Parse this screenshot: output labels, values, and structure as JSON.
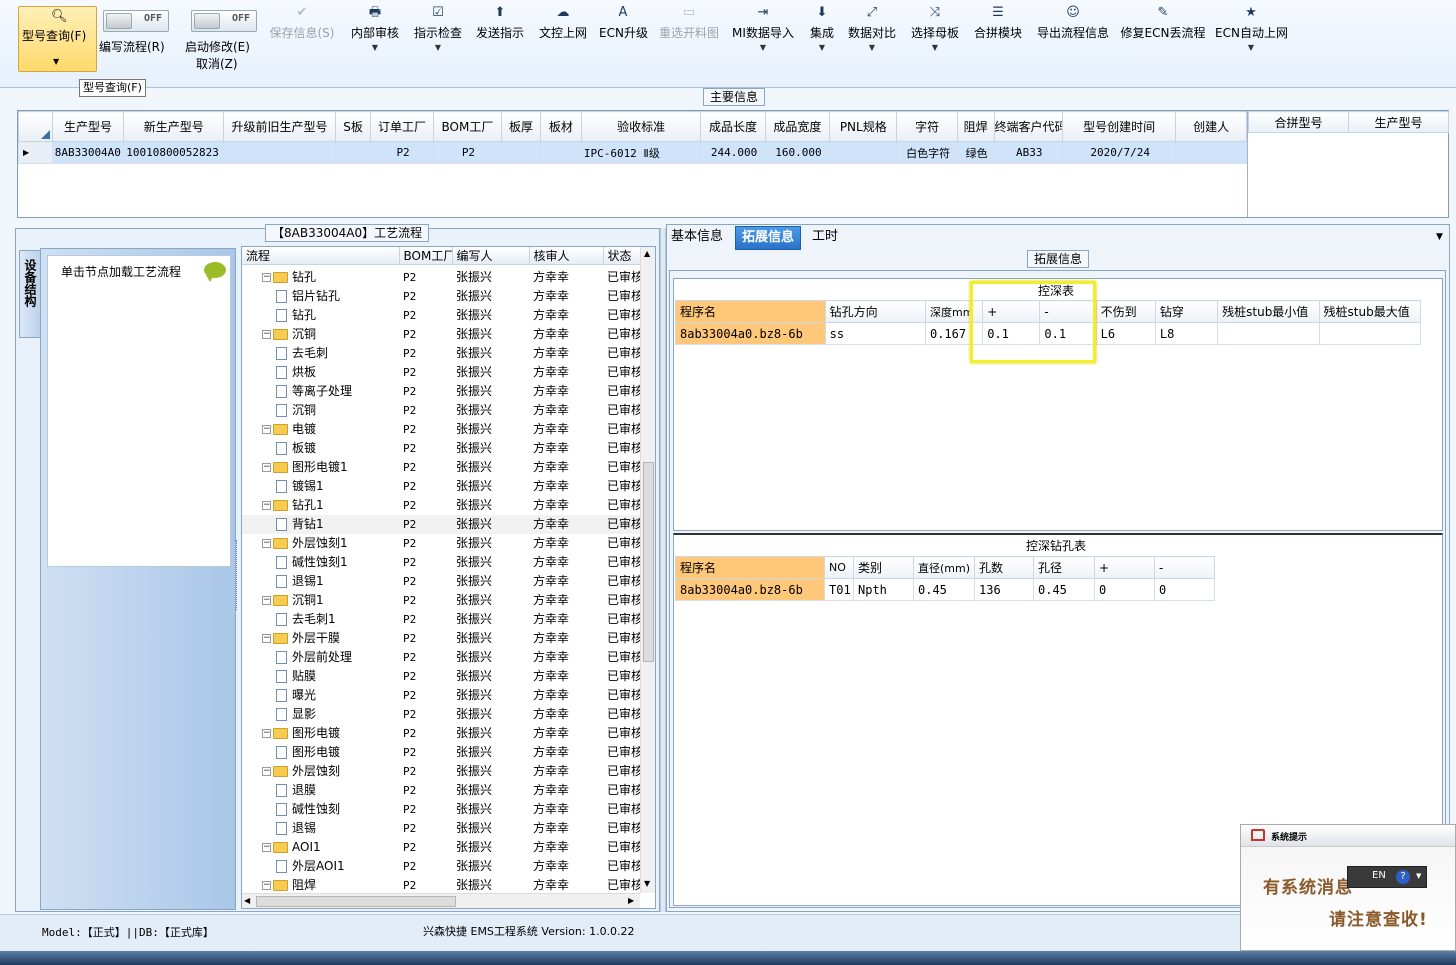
{
  "toolbar": {
    "query_label": "型号查询(F)",
    "edit_flow_label": "编写流程(R)",
    "edit_flow_toggle": "OFF",
    "start_modify_label": "启动修改(E)",
    "start_modify_toggle": "OFF",
    "cancel_label": "取消(Z)",
    "buttons": [
      {
        "label": "保存信息(S)",
        "icon": "✔",
        "disabled": true
      },
      {
        "label": "内部审核",
        "icon": "🖶",
        "disabled": false
      },
      {
        "label": "指示检查",
        "icon": "☑",
        "disabled": false
      },
      {
        "label": "发送指示",
        "icon": "⬆",
        "disabled": false
      },
      {
        "label": "文控上网",
        "icon": "☁",
        "disabled": false
      },
      {
        "label": "ECN升级",
        "icon": "A",
        "disabled": false
      },
      {
        "label": "重选开料图",
        "icon": "▭",
        "disabled": true
      },
      {
        "label": "MI数据导入",
        "icon": "⇥",
        "disabled": false
      },
      {
        "label": "集成",
        "icon": "⬇",
        "disabled": false
      },
      {
        "label": "数据对比",
        "icon": "⤢",
        "disabled": false
      },
      {
        "label": "选择母板",
        "icon": "⤨",
        "disabled": false
      },
      {
        "label": "合拼模块",
        "icon": "☰",
        "disabled": false
      },
      {
        "label": "导出流程信息",
        "icon": "☺",
        "disabled": false
      },
      {
        "label": "修复ECN丢流程",
        "icon": "✎",
        "disabled": false
      },
      {
        "label": "ECN自动上网",
        "icon": "★",
        "disabled": false
      }
    ],
    "tooltip": "型号查询(F)"
  },
  "main_info": {
    "caption": "主要信息",
    "columns": [
      "生产型号",
      "新生产型号",
      "升级前旧生产型号",
      "S板",
      "订单工厂",
      "BOM工厂",
      "板厚",
      "板材",
      "验收标准",
      "成品长度",
      "成品宽度",
      "PNL规格",
      "字符",
      "阻焊",
      "终端客户代码",
      "型号创建时间",
      "创建人"
    ],
    "row": [
      "8AB33004A0",
      "10010800052823",
      "",
      "",
      "P2",
      "P2",
      "",
      "",
      "IPC-6012 Ⅱ级",
      "244.000",
      "160.000",
      "",
      "白色字符",
      "绿色",
      "AB33",
      "2020/7/24",
      ""
    ],
    "merge_columns": [
      "合拼型号",
      "生产型号"
    ]
  },
  "flow": {
    "caption": "【8AB33004A0】工艺流程",
    "side_tab": "设备结构",
    "hint": "单击节点加载工艺流程",
    "columns": [
      "流程",
      "BOM工厂",
      "编写人",
      "核审人",
      "状态"
    ],
    "rows": [
      {
        "name": "钻孔",
        "level": 0,
        "bom": "P2",
        "writer": "张振兴",
        "reviewer": "方幸幸",
        "status": "已审核"
      },
      {
        "name": "铝片钻孔",
        "level": 1,
        "bom": "P2",
        "writer": "张振兴",
        "reviewer": "方幸幸",
        "status": "已审核"
      },
      {
        "name": "钻孔",
        "level": 1,
        "bom": "P2",
        "writer": "张振兴",
        "reviewer": "方幸幸",
        "status": "已审核"
      },
      {
        "name": "沉铜",
        "level": 0,
        "bom": "P2",
        "writer": "张振兴",
        "reviewer": "方幸幸",
        "status": "已审核"
      },
      {
        "name": "去毛刺",
        "level": 1,
        "bom": "P2",
        "writer": "张振兴",
        "reviewer": "方幸幸",
        "status": "已审核"
      },
      {
        "name": "烘板",
        "level": 1,
        "bom": "P2",
        "writer": "张振兴",
        "reviewer": "方幸幸",
        "status": "已审核"
      },
      {
        "name": "等离子处理",
        "level": 1,
        "bom": "P2",
        "writer": "张振兴",
        "reviewer": "方幸幸",
        "status": "已审核"
      },
      {
        "name": "沉铜",
        "level": 1,
        "bom": "P2",
        "writer": "张振兴",
        "reviewer": "方幸幸",
        "status": "已审核"
      },
      {
        "name": "电镀",
        "level": 0,
        "bom": "P2",
        "writer": "张振兴",
        "reviewer": "方幸幸",
        "status": "已审核"
      },
      {
        "name": "板镀",
        "level": 1,
        "bom": "P2",
        "writer": "张振兴",
        "reviewer": "方幸幸",
        "status": "已审核"
      },
      {
        "name": "图形电镀1",
        "level": 0,
        "bom": "P2",
        "writer": "张振兴",
        "reviewer": "方幸幸",
        "status": "已审核"
      },
      {
        "name": "镀锡1",
        "level": 1,
        "bom": "P2",
        "writer": "张振兴",
        "reviewer": "方幸幸",
        "status": "已审核"
      },
      {
        "name": "钻孔1",
        "level": 0,
        "bom": "P2",
        "writer": "张振兴",
        "reviewer": "方幸幸",
        "status": "已审核"
      },
      {
        "name": "背钻1",
        "level": 1,
        "bom": "P2",
        "writer": "张振兴",
        "reviewer": "方幸幸",
        "status": "已审核"
      },
      {
        "name": "外层蚀刻1",
        "level": 0,
        "bom": "P2",
        "writer": "张振兴",
        "reviewer": "方幸幸",
        "status": "已审核"
      },
      {
        "name": "碱性蚀刻1",
        "level": 1,
        "bom": "P2",
        "writer": "张振兴",
        "reviewer": "方幸幸",
        "status": "已审核"
      },
      {
        "name": "退锡1",
        "level": 1,
        "bom": "P2",
        "writer": "张振兴",
        "reviewer": "方幸幸",
        "status": "已审核"
      },
      {
        "name": "沉铜1",
        "level": 0,
        "bom": "P2",
        "writer": "张振兴",
        "reviewer": "方幸幸",
        "status": "已审核"
      },
      {
        "name": "去毛刺1",
        "level": 1,
        "bom": "P2",
        "writer": "张振兴",
        "reviewer": "方幸幸",
        "status": "已审核"
      },
      {
        "name": "外层干膜",
        "level": 0,
        "bom": "P2",
        "writer": "张振兴",
        "reviewer": "方幸幸",
        "status": "已审核"
      },
      {
        "name": "外层前处理",
        "level": 1,
        "bom": "P2",
        "writer": "张振兴",
        "reviewer": "方幸幸",
        "status": "已审核"
      },
      {
        "name": "贴膜",
        "level": 1,
        "bom": "P2",
        "writer": "张振兴",
        "reviewer": "方幸幸",
        "status": "已审核"
      },
      {
        "name": "曝光",
        "level": 1,
        "bom": "P2",
        "writer": "张振兴",
        "reviewer": "方幸幸",
        "status": "已审核"
      },
      {
        "name": "显影",
        "level": 1,
        "bom": "P2",
        "writer": "张振兴",
        "reviewer": "方幸幸",
        "status": "已审核"
      },
      {
        "name": "图形电镀",
        "level": 0,
        "bom": "P2",
        "writer": "张振兴",
        "reviewer": "方幸幸",
        "status": "已审核"
      },
      {
        "name": "图形电镀",
        "level": 1,
        "bom": "P2",
        "writer": "张振兴",
        "reviewer": "方幸幸",
        "status": "已审核"
      },
      {
        "name": "外层蚀刻",
        "level": 0,
        "bom": "P2",
        "writer": "张振兴",
        "reviewer": "方幸幸",
        "status": "已审核"
      },
      {
        "name": "退膜",
        "level": 1,
        "bom": "P2",
        "writer": "张振兴",
        "reviewer": "方幸幸",
        "status": "已审核"
      },
      {
        "name": "碱性蚀刻",
        "level": 1,
        "bom": "P2",
        "writer": "张振兴",
        "reviewer": "方幸幸",
        "status": "已审核"
      },
      {
        "name": "退锡",
        "level": 1,
        "bom": "P2",
        "writer": "张振兴",
        "reviewer": "方幸幸",
        "status": "已审核"
      },
      {
        "name": "AOI1",
        "level": 0,
        "bom": "P2",
        "writer": "张振兴",
        "reviewer": "方幸幸",
        "status": "已审核"
      },
      {
        "name": "外层AOI1",
        "level": 1,
        "bom": "P2",
        "writer": "张振兴",
        "reviewer": "方幸幸",
        "status": "已审核"
      },
      {
        "name": "阻焊",
        "level": 0,
        "bom": "P2",
        "writer": "张振兴",
        "reviewer": "方幸幸",
        "status": "已审核"
      }
    ]
  },
  "tabs": {
    "basic": "基本信息",
    "extended": "拓展信息",
    "hours": "工时"
  },
  "extended": {
    "caption": "拓展信息",
    "depth_group": "控深表",
    "table1": {
      "columns": [
        "程序名",
        "钻孔方向",
        "深度mm",
        "+",
        "-",
        "不伤到",
        "钻穿",
        "残桩stub最小值",
        "残桩stub最大值"
      ],
      "row": [
        "8ab33004a0.bz8-6b",
        "ss",
        "0.167",
        "0.1",
        "0.1",
        "L6",
        "L8",
        "",
        ""
      ]
    },
    "table2": {
      "title": "控深钻孔表",
      "columns": [
        "程序名",
        "NO",
        "类别",
        "直径(mm)",
        "孔数",
        "孔径",
        "+",
        "-"
      ],
      "row": [
        "8ab33004a0.bz8-6b",
        "T01",
        "Npth",
        "0.45",
        "136",
        "0.45",
        "0",
        "0"
      ]
    }
  },
  "notification": {
    "title": "系统提示",
    "line1": "有系统消息",
    "line2": "请注意查收!",
    "lang": "EN"
  },
  "status": {
    "model": "Model:【正式】||DB:【正式库】",
    "app": "兴森快捷 EMS工程系统 Version: 1.0.0.22"
  }
}
